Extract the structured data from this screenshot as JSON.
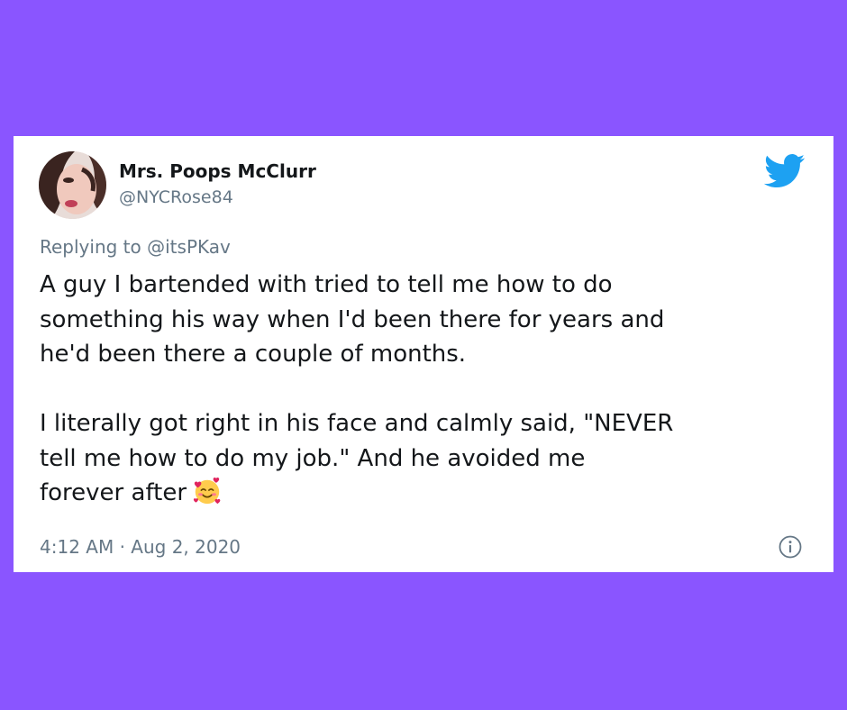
{
  "tweet": {
    "author": {
      "display_name": "Mrs. Poops McClurr",
      "handle": "@NYCRose84",
      "avatar": "profile-photo"
    },
    "replying_to_prefix": "Replying to",
    "replying_to_handle": "@itsPKav",
    "body_lines": [
      "A guy I bartended with tried to tell me how to do",
      "something his way when I'd been there for years and",
      "he'd been there a couple of months.",
      "I literally got right in his face and calmly said, \"NEVER",
      "tell me how to do my job.\" And he avoided me",
      "forever after"
    ],
    "trailing_emoji": "smiling-face-with-hearts",
    "timestamp": "4:12 AM · Aug 2, 2020",
    "brand_icon": "twitter-bird-icon",
    "info_icon": "info-icon"
  },
  "colors": {
    "background": "#8a55ff",
    "card": "#ffffff",
    "text_primary": "#14171a",
    "text_secondary": "#657786",
    "twitter_blue": "#1da1f2"
  }
}
